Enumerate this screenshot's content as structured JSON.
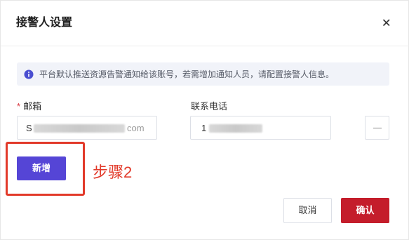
{
  "dialog": {
    "title": "接警人设置",
    "close_icon": "close-icon"
  },
  "notice": {
    "icon": "info-icon",
    "icon_color": "#4a4ed0",
    "text": "平台默认推送资源告警通知给该账号，若需增加通知人员，请配置接警人信息。"
  },
  "form": {
    "email_label": "邮箱",
    "required_mark": "*",
    "email_value": "S",
    "email_value_suffix": "com",
    "phone_label": "联系电话",
    "phone_value": "1",
    "remove_icon": "minus-icon"
  },
  "actions": {
    "add_label": "新增",
    "step_annotation": "步骤2",
    "cancel_label": "取消",
    "confirm_label": "确认"
  },
  "colors": {
    "primary": "#5545d6",
    "confirm": "#c41d2b",
    "annotation": "#e23a2a"
  }
}
